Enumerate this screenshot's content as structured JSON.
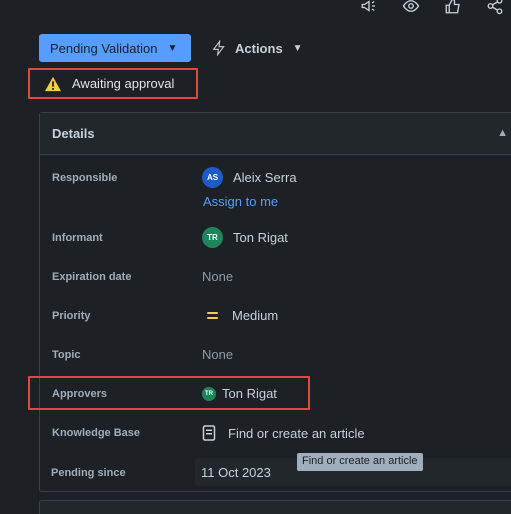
{
  "toolbar": {
    "icons": [
      "megaphone-icon",
      "eye-icon",
      "thumbs-up-icon",
      "share-icon"
    ]
  },
  "status": {
    "label": "Pending Validation",
    "actions_label": "Actions",
    "awaiting_text": "Awaiting approval"
  },
  "details": {
    "title": "Details",
    "fields": {
      "responsible": {
        "label": "Responsible",
        "initials": "AS",
        "name": "Aleix Serra",
        "assign_link": "Assign to me"
      },
      "informant": {
        "label": "Informant",
        "initials": "TR",
        "name": "Ton Rigat"
      },
      "expiration": {
        "label": "Expiration date",
        "value": "None"
      },
      "priority": {
        "label": "Priority",
        "value": "Medium"
      },
      "topic": {
        "label": "Topic",
        "value": "None"
      },
      "approvers": {
        "label": "Approvers",
        "initials": "TR",
        "name": "Ton Rigat"
      },
      "knowledge_base": {
        "label": "Knowledge Base",
        "value": "Find or create an article"
      },
      "pending_since": {
        "label": "Pending since",
        "value": "11 Oct 2023"
      }
    },
    "tooltip": "Find or create an article"
  },
  "colors": {
    "accent": "#579dff",
    "highlight_border": "#e2483d",
    "priority_medium": "#f5cd47",
    "avatar_blue": "#1d5cc8",
    "avatar_green": "#1f845a"
  }
}
